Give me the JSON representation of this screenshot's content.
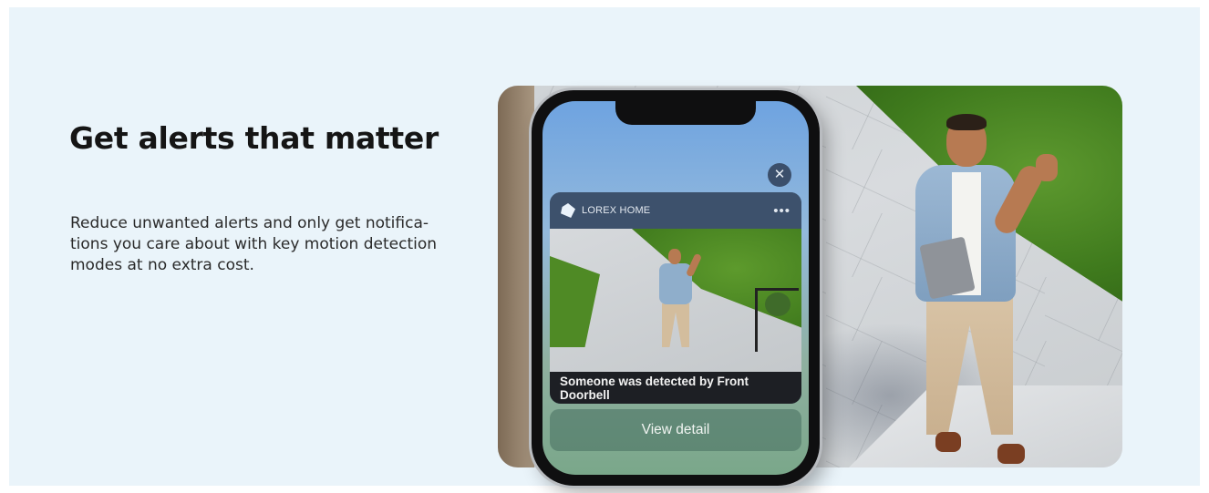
{
  "heading": {
    "title": "Get alerts that matter",
    "description": "Reduce unwanted alerts and only get notifica-tions you care about with key motion detection modes at no extra cost."
  },
  "phone": {
    "notification": {
      "app_name": "LOREX HOME",
      "message": "Someone was detected by Front Doorbell",
      "more_icon": "ellipsis-icon"
    },
    "close_icon": "close-icon",
    "close_glyph": "✕",
    "more_glyph": "•••",
    "action_label": "View detail"
  },
  "colors": {
    "panel_bg": "#eaf4fa",
    "notification_header": "#3d516c",
    "notification_text_bg": "#1d1f24"
  }
}
